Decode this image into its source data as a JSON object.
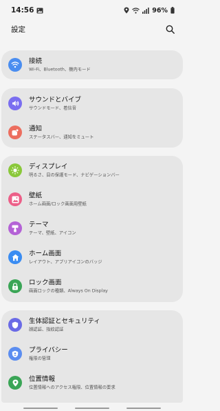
{
  "status_bar": {
    "time": "14:56",
    "battery": "96%"
  },
  "header": {
    "title": "設定"
  },
  "groups": [
    {
      "items": [
        {
          "title": "接続",
          "subtitle": "Wi-Fi、Bluetooth、機内モード",
          "icon": "wifi-icon",
          "color": "#4a8df0"
        }
      ]
    },
    {
      "items": [
        {
          "title": "サウンドとバイブ",
          "subtitle": "サウンドモード、着信音",
          "icon": "volume-icon",
          "color": "#7a6ef0"
        },
        {
          "title": "通知",
          "subtitle": "ステータスバー、通知をミュート",
          "icon": "notification-icon",
          "color": "#ec6e5f"
        }
      ]
    },
    {
      "items": [
        {
          "title": "ディスプレイ",
          "subtitle": "明るさ、目の保護モード、ナビゲーションバー",
          "icon": "brightness-icon",
          "color": "#8ac83a"
        },
        {
          "title": "壁紙",
          "subtitle": "ホーム画面/ロック画面用壁紙",
          "icon": "wallpaper-icon",
          "color": "#ec5f88"
        },
        {
          "title": "テーマ",
          "subtitle": "テーマ、壁紙、アイコン",
          "icon": "theme-icon",
          "color": "#b462d6"
        },
        {
          "title": "ホーム画面",
          "subtitle": "レイアウト、アプリアイコンのバッジ",
          "icon": "home-icon",
          "color": "#3a8cf2"
        },
        {
          "title": "ロック画面",
          "subtitle": "画面ロックの種類、Always On Display",
          "icon": "lock-icon",
          "color": "#3aa556"
        }
      ]
    },
    {
      "items": [
        {
          "title": "生体認証とセキュリティ",
          "subtitle": "顔認証、指紋認証",
          "icon": "shield-icon",
          "color": "#6a6ae6"
        },
        {
          "title": "プライバシー",
          "subtitle": "権限の管理",
          "icon": "privacy-icon",
          "color": "#5b8df0"
        },
        {
          "title": "位置情報",
          "subtitle": "位置情報へのアクセス権限、位置情報の要求",
          "icon": "location-icon",
          "color": "#3aa556"
        }
      ]
    }
  ]
}
